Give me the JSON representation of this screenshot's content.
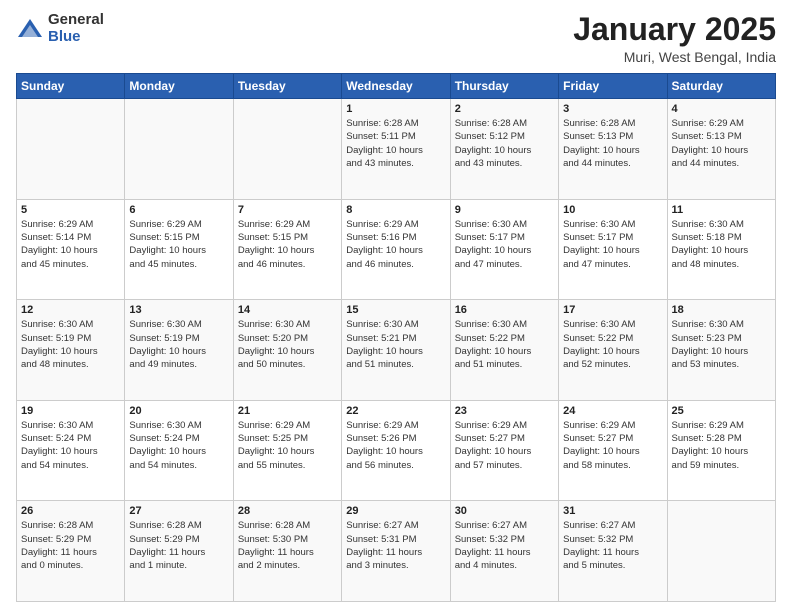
{
  "header": {
    "logo": {
      "line1": "General",
      "line2": "Blue"
    },
    "title": "January 2025",
    "subtitle": "Muri, West Bengal, India"
  },
  "weekdays": [
    "Sunday",
    "Monday",
    "Tuesday",
    "Wednesday",
    "Thursday",
    "Friday",
    "Saturday"
  ],
  "weeks": [
    [
      {
        "day": "",
        "info": ""
      },
      {
        "day": "",
        "info": ""
      },
      {
        "day": "",
        "info": ""
      },
      {
        "day": "1",
        "info": "Sunrise: 6:28 AM\nSunset: 5:11 PM\nDaylight: 10 hours\nand 43 minutes."
      },
      {
        "day": "2",
        "info": "Sunrise: 6:28 AM\nSunset: 5:12 PM\nDaylight: 10 hours\nand 43 minutes."
      },
      {
        "day": "3",
        "info": "Sunrise: 6:28 AM\nSunset: 5:13 PM\nDaylight: 10 hours\nand 44 minutes."
      },
      {
        "day": "4",
        "info": "Sunrise: 6:29 AM\nSunset: 5:13 PM\nDaylight: 10 hours\nand 44 minutes."
      }
    ],
    [
      {
        "day": "5",
        "info": "Sunrise: 6:29 AM\nSunset: 5:14 PM\nDaylight: 10 hours\nand 45 minutes."
      },
      {
        "day": "6",
        "info": "Sunrise: 6:29 AM\nSunset: 5:15 PM\nDaylight: 10 hours\nand 45 minutes."
      },
      {
        "day": "7",
        "info": "Sunrise: 6:29 AM\nSunset: 5:15 PM\nDaylight: 10 hours\nand 46 minutes."
      },
      {
        "day": "8",
        "info": "Sunrise: 6:29 AM\nSunset: 5:16 PM\nDaylight: 10 hours\nand 46 minutes."
      },
      {
        "day": "9",
        "info": "Sunrise: 6:30 AM\nSunset: 5:17 PM\nDaylight: 10 hours\nand 47 minutes."
      },
      {
        "day": "10",
        "info": "Sunrise: 6:30 AM\nSunset: 5:17 PM\nDaylight: 10 hours\nand 47 minutes."
      },
      {
        "day": "11",
        "info": "Sunrise: 6:30 AM\nSunset: 5:18 PM\nDaylight: 10 hours\nand 48 minutes."
      }
    ],
    [
      {
        "day": "12",
        "info": "Sunrise: 6:30 AM\nSunset: 5:19 PM\nDaylight: 10 hours\nand 48 minutes."
      },
      {
        "day": "13",
        "info": "Sunrise: 6:30 AM\nSunset: 5:19 PM\nDaylight: 10 hours\nand 49 minutes."
      },
      {
        "day": "14",
        "info": "Sunrise: 6:30 AM\nSunset: 5:20 PM\nDaylight: 10 hours\nand 50 minutes."
      },
      {
        "day": "15",
        "info": "Sunrise: 6:30 AM\nSunset: 5:21 PM\nDaylight: 10 hours\nand 51 minutes."
      },
      {
        "day": "16",
        "info": "Sunrise: 6:30 AM\nSunset: 5:22 PM\nDaylight: 10 hours\nand 51 minutes."
      },
      {
        "day": "17",
        "info": "Sunrise: 6:30 AM\nSunset: 5:22 PM\nDaylight: 10 hours\nand 52 minutes."
      },
      {
        "day": "18",
        "info": "Sunrise: 6:30 AM\nSunset: 5:23 PM\nDaylight: 10 hours\nand 53 minutes."
      }
    ],
    [
      {
        "day": "19",
        "info": "Sunrise: 6:30 AM\nSunset: 5:24 PM\nDaylight: 10 hours\nand 54 minutes."
      },
      {
        "day": "20",
        "info": "Sunrise: 6:30 AM\nSunset: 5:24 PM\nDaylight: 10 hours\nand 54 minutes."
      },
      {
        "day": "21",
        "info": "Sunrise: 6:29 AM\nSunset: 5:25 PM\nDaylight: 10 hours\nand 55 minutes."
      },
      {
        "day": "22",
        "info": "Sunrise: 6:29 AM\nSunset: 5:26 PM\nDaylight: 10 hours\nand 56 minutes."
      },
      {
        "day": "23",
        "info": "Sunrise: 6:29 AM\nSunset: 5:27 PM\nDaylight: 10 hours\nand 57 minutes."
      },
      {
        "day": "24",
        "info": "Sunrise: 6:29 AM\nSunset: 5:27 PM\nDaylight: 10 hours\nand 58 minutes."
      },
      {
        "day": "25",
        "info": "Sunrise: 6:29 AM\nSunset: 5:28 PM\nDaylight: 10 hours\nand 59 minutes."
      }
    ],
    [
      {
        "day": "26",
        "info": "Sunrise: 6:28 AM\nSunset: 5:29 PM\nDaylight: 11 hours\nand 0 minutes."
      },
      {
        "day": "27",
        "info": "Sunrise: 6:28 AM\nSunset: 5:29 PM\nDaylight: 11 hours\nand 1 minute."
      },
      {
        "day": "28",
        "info": "Sunrise: 6:28 AM\nSunset: 5:30 PM\nDaylight: 11 hours\nand 2 minutes."
      },
      {
        "day": "29",
        "info": "Sunrise: 6:27 AM\nSunset: 5:31 PM\nDaylight: 11 hours\nand 3 minutes."
      },
      {
        "day": "30",
        "info": "Sunrise: 6:27 AM\nSunset: 5:32 PM\nDaylight: 11 hours\nand 4 minutes."
      },
      {
        "day": "31",
        "info": "Sunrise: 6:27 AM\nSunset: 5:32 PM\nDaylight: 11 hours\nand 5 minutes."
      },
      {
        "day": "",
        "info": ""
      }
    ]
  ]
}
